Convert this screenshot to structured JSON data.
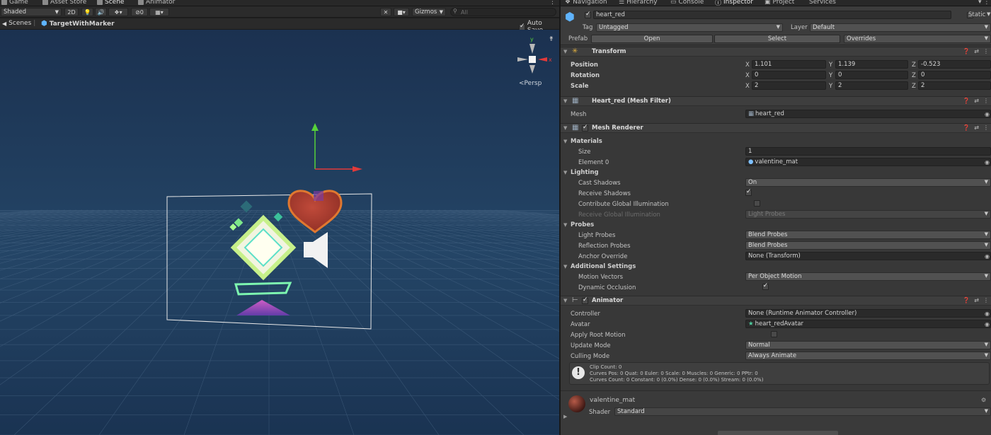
{
  "left_tabs": [
    {
      "label": "Game",
      "icon": "game-icon"
    },
    {
      "label": "Asset Store",
      "icon": "asset-store-icon"
    },
    {
      "label": "Scene",
      "icon": "scene-icon"
    },
    {
      "label": "Animator",
      "icon": "animator-icon"
    }
  ],
  "scene_toolbar": {
    "shading_mode": "Shaded",
    "mode_2d": "2D",
    "hidden_count": "0",
    "gizmos": "Gizmos",
    "search_placeholder": "All"
  },
  "breadcrumb": {
    "scenes": "Scenes",
    "prefab": "TargetWithMarker",
    "auto_save": "Auto Save"
  },
  "scene_gizmo": {
    "x_label": "x",
    "y_label": "y",
    "projection": "Persp"
  },
  "right_tabs": [
    {
      "label": "Navigation",
      "icon": "navigation-icon"
    },
    {
      "label": "Hierarchy",
      "icon": "hierarchy-icon"
    },
    {
      "label": "Console",
      "icon": "console-icon"
    },
    {
      "label": "Inspector",
      "icon": "inspector-icon"
    },
    {
      "label": "Project",
      "icon": "project-icon"
    },
    {
      "label": "Services",
      "icon": "services-icon"
    }
  ],
  "inspector": {
    "object_name": "heart_red",
    "static_label": "Static",
    "tag_label": "Tag",
    "tag_value": "Untagged",
    "layer_label": "Layer",
    "layer_value": "Default",
    "prefab_label": "Prefab",
    "open_label": "Open",
    "select_label": "Select",
    "overrides_label": "Overrides"
  },
  "transform": {
    "title": "Transform",
    "position_label": "Position",
    "rotation_label": "Rotation",
    "scale_label": "Scale",
    "position": {
      "x": "1.101",
      "y": "1.139",
      "z": "-0.523"
    },
    "rotation": {
      "x": "0",
      "y": "0",
      "z": "0"
    },
    "scale": {
      "x": "2",
      "y": "2",
      "z": "2"
    },
    "axis_x": "X",
    "axis_y": "Y",
    "axis_z": "Z"
  },
  "mesh_filter": {
    "title": "Heart_red (Mesh Filter)",
    "mesh_label": "Mesh",
    "mesh_value": "heart_red"
  },
  "mesh_renderer": {
    "title": "Mesh Renderer",
    "materials": "Materials",
    "size_label": "Size",
    "size_value": "1",
    "element0_label": "Element 0",
    "element0_value": "valentine_mat",
    "lighting": "Lighting",
    "cast_shadows_label": "Cast Shadows",
    "cast_shadows_value": "On",
    "receive_shadows_label": "Receive Shadows",
    "contribute_gi_label": "Contribute Global Illumination",
    "receive_gi_label": "Receive Global Illumination",
    "receive_gi_value": "Light Probes",
    "probes": "Probes",
    "light_probes_label": "Light Probes",
    "light_probes_value": "Blend Probes",
    "reflection_probes_label": "Reflection Probes",
    "reflection_probes_value": "Blend Probes",
    "anchor_override_label": "Anchor Override",
    "anchor_override_value": "None (Transform)",
    "additional_settings": "Additional Settings",
    "motion_vectors_label": "Motion Vectors",
    "motion_vectors_value": "Per Object Motion",
    "dynamic_occlusion_label": "Dynamic Occlusion"
  },
  "animator": {
    "title": "Animator",
    "controller_label": "Controller",
    "controller_value": "None (Runtime Animator Controller)",
    "avatar_label": "Avatar",
    "avatar_value": "heart_redAvatar",
    "apply_root_motion_label": "Apply Root Motion",
    "update_mode_label": "Update Mode",
    "update_mode_value": "Normal",
    "culling_mode_label": "Culling Mode",
    "culling_mode_value": "Always Animate",
    "info_line1": "Clip Count: 0",
    "info_line2": "Curves Pos: 0 Quat: 0 Euler: 0 Scale: 0 Muscles: 0 Generic: 0 PPtr: 0",
    "info_line3": "Curves Count: 0 Constant: 0 (0.0%) Dense: 0 (0.0%) Stream: 0 (0.0%)"
  },
  "material": {
    "name": "valentine_mat",
    "shader_label": "Shader",
    "shader_value": "Standard"
  },
  "colors": {
    "scene_sky": "#1f3a5a",
    "inspector_bg": "#383838",
    "heart": "#c0452f",
    "gizmo_x": "#e23a3a",
    "gizmo_y": "#56d13a"
  }
}
